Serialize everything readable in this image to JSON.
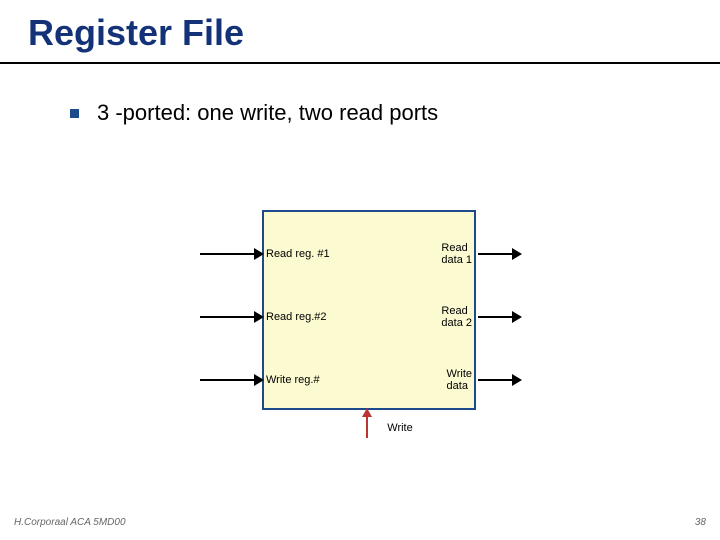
{
  "title": "Register File",
  "bullet": "3 -ported: one write, two read ports",
  "ports": {
    "in1": "Read reg. #1",
    "out1a": "Read",
    "out1b": "data 1",
    "in2": "Read reg.#2",
    "out2a": "Read",
    "out2b": "data 2",
    "in3": "Write reg.#",
    "out3a": "Write",
    "out3b": "data"
  },
  "write_ctl": "Write",
  "footer_left": "H.Corporaal  ACA 5MD00",
  "footer_right": "38",
  "chart_data": {
    "type": "diagram",
    "title": "Register File",
    "component": "Register File (3-ported)",
    "inputs": [
      "Read reg. #1",
      "Read reg.#2",
      "Write reg.#",
      "Write data",
      "Write (control)"
    ],
    "outputs": [
      "Read data 1",
      "Read data 2"
    ],
    "note": "one write port, two read ports"
  }
}
